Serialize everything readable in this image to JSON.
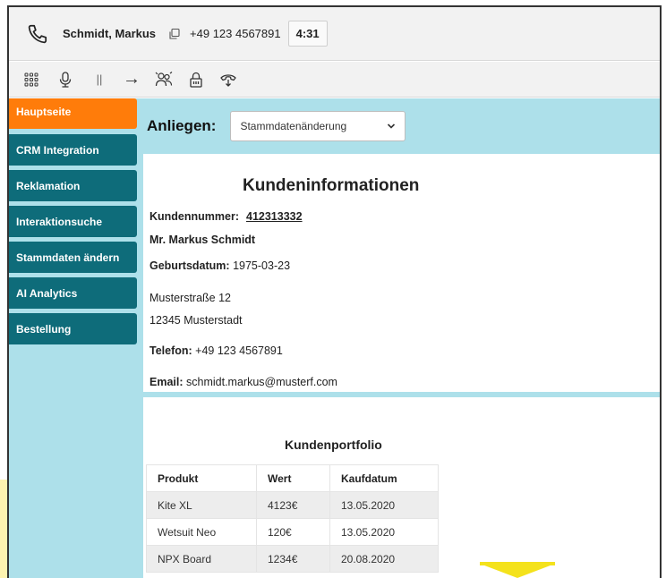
{
  "call": {
    "caller_name": "Schmidt, Markus",
    "phone_number": "+49 123 4567891",
    "timer": "4:31"
  },
  "toolbar": {
    "icons": [
      "dialpad-icon",
      "microphone-icon",
      "pause-icon",
      "forward-icon",
      "conference-icon",
      "lock-icon",
      "hangup-icon"
    ],
    "pause_glyph": "||",
    "forward_glyph": "→"
  },
  "sidebar": {
    "items": [
      {
        "label": "Hauptseite",
        "active": true
      },
      {
        "label": "CRM Integration",
        "active": false
      },
      {
        "label": "Reklamation",
        "active": false
      },
      {
        "label": "Interaktionsuche",
        "active": false
      },
      {
        "label": "Stammdaten ändern",
        "active": false
      },
      {
        "label": "AI Analytics",
        "active": false
      },
      {
        "label": "Bestellung",
        "active": false
      }
    ]
  },
  "anliegen": {
    "label": "Anliegen:",
    "selected": "Stammdatenänderung"
  },
  "customer": {
    "title": "Kundeninformationen",
    "number_label": "Kundennummer:",
    "number": "412313332",
    "name": "Mr. Markus Schmidt",
    "birth_label": "Geburtsdatum:",
    "birth_date": "1975-03-23",
    "street": "Musterstraße 12",
    "city": "12345 Musterstadt",
    "phone_label": "Telefon:",
    "phone": "+49 123 4567891",
    "email_label": "Email:",
    "email": "schmidt.markus@musterf.com"
  },
  "portfolio": {
    "title": "Kundenportfolio",
    "headers": [
      "Produkt",
      "Wert",
      "Kaufdatum"
    ],
    "rows": [
      [
        "Kite XL",
        "4123€",
        "13.05.2020"
      ],
      [
        "Wetsuit Neo",
        "120€",
        "13.05.2020"
      ],
      [
        "NPX Board",
        "1234€",
        "20.08.2020"
      ]
    ]
  },
  "colors": {
    "sidebar_bg": "#ade0ea",
    "nav_item": "#0e6c7a",
    "nav_active": "#ff7c0a",
    "accent_yellow": "#f4e21c"
  }
}
